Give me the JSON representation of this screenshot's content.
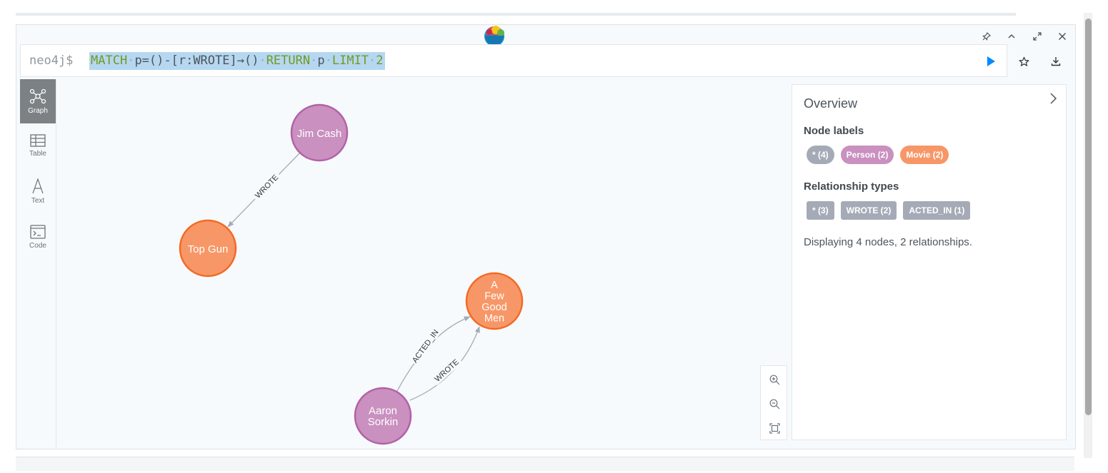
{
  "editor": {
    "prompt": "neo4j$",
    "query_tokens": [
      {
        "t": "MATCH",
        "c": "kw"
      },
      {
        "t": "·",
        "c": "sp"
      },
      {
        "t": "p=()-[r:WROTE]→()",
        "c": "tx"
      },
      {
        "t": "·",
        "c": "sp"
      },
      {
        "t": "RETURN",
        "c": "kw"
      },
      {
        "t": "·",
        "c": "sp"
      },
      {
        "t": "p",
        "c": "tx"
      },
      {
        "t": "·",
        "c": "sp"
      },
      {
        "t": "LIMIT",
        "c": "kw"
      },
      {
        "t": "·",
        "c": "sp"
      },
      {
        "t": "2",
        "c": "kw"
      }
    ]
  },
  "sidebar": {
    "items": [
      {
        "label": "Graph",
        "icon": "graph-icon",
        "active": true
      },
      {
        "label": "Table",
        "icon": "table-icon",
        "active": false
      },
      {
        "label": "Text",
        "icon": "text-icon",
        "active": false
      },
      {
        "label": "Code",
        "icon": "code-icon",
        "active": false
      }
    ]
  },
  "graph": {
    "nodes": [
      {
        "id": "jim",
        "label": "Jim Cash",
        "kind": "Person"
      },
      {
        "id": "topgun",
        "label": "Top Gun",
        "kind": "Movie"
      },
      {
        "id": "afgm",
        "label": "A Few Good Men",
        "kind": "Movie"
      },
      {
        "id": "aaron",
        "label": "Aaron Sorkin",
        "kind": "Person"
      }
    ],
    "relationships": [
      {
        "from": "jim",
        "to": "topgun",
        "type": "WROTE"
      },
      {
        "from": "aaron",
        "to": "afgm",
        "type": "ACTED_IN"
      },
      {
        "from": "aaron",
        "to": "afgm",
        "type": "WROTE"
      }
    ],
    "colors": {
      "Person_fill": "#c990c0",
      "Person_stroke": "#b261a5",
      "Movie_fill": "#f79767",
      "Movie_stroke": "#f36924",
      "edge": "#a5abb6"
    }
  },
  "overview": {
    "title": "Overview",
    "node_labels_heading": "Node labels",
    "node_labels": [
      {
        "text": "* (4)",
        "color": "#a5abb6"
      },
      {
        "text": "Person (2)",
        "color": "#c990c0"
      },
      {
        "text": "Movie (2)",
        "color": "#f79767"
      }
    ],
    "relationship_types_heading": "Relationship types",
    "relationship_types": [
      {
        "text": "* (3)",
        "color": "#a5abb6"
      },
      {
        "text": "WROTE (2)",
        "color": "#a5abb6"
      },
      {
        "text": "ACTED_IN (1)",
        "color": "#a5abb6"
      }
    ],
    "summary": "Displaying 4 nodes, 2 relationships."
  },
  "controls": {
    "run": "play-icon",
    "favorite": "star-icon",
    "download": "download-icon",
    "pin": "pin-icon",
    "collapse": "chevron-up-icon",
    "fullscreen": "expand-icon",
    "close": "close-icon"
  }
}
